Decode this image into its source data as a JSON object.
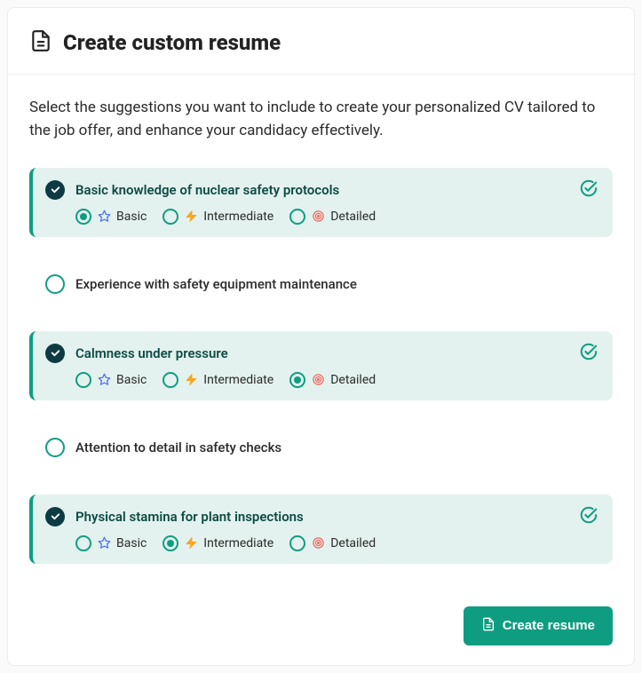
{
  "header": {
    "title": "Create custom resume",
    "icon": "document-icon"
  },
  "description": "Select the suggestions you want to include to create your personalized CV tailored to the job offer, and enhance your candidacy effectively.",
  "levels": {
    "basic": {
      "label": "Basic",
      "icon": "star-icon",
      "icon_color": "#4a6cf7"
    },
    "intermediate": {
      "label": "Intermediate",
      "icon": "bolt-icon",
      "icon_color": "#f5a623"
    },
    "detailed": {
      "label": "Detailed",
      "icon": "target-icon",
      "icon_color": "#f06a5f"
    }
  },
  "suggestions": [
    {
      "title": "Basic knowledge of nuclear safety protocols",
      "selected": true,
      "level": "basic"
    },
    {
      "title": "Experience with safety equipment maintenance",
      "selected": false,
      "level": null
    },
    {
      "title": "Calmness under pressure",
      "selected": true,
      "level": "detailed"
    },
    {
      "title": "Attention to detail in safety checks",
      "selected": false,
      "level": null
    },
    {
      "title": "Physical stamina for plant inspections",
      "selected": true,
      "level": "intermediate"
    }
  ],
  "actions": {
    "create_label": "Create resume",
    "create_icon": "document-icon"
  },
  "colors": {
    "accent": "#0f9d82",
    "dark_check": "#0e3b43",
    "active_bg": "#e3f2ee"
  }
}
